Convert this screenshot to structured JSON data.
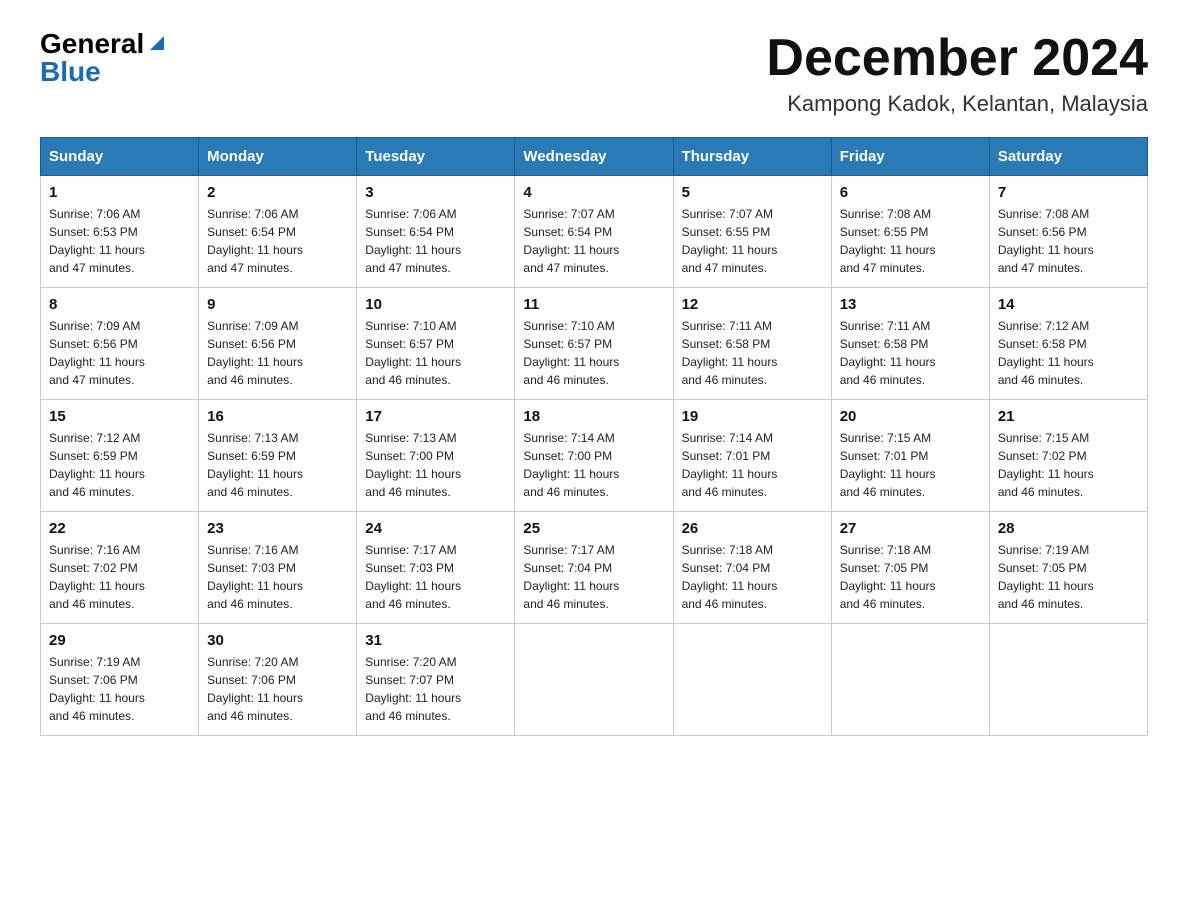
{
  "header": {
    "logo_general": "General",
    "logo_blue": "Blue",
    "month_title": "December 2024",
    "location": "Kampong Kadok, Kelantan, Malaysia"
  },
  "weekdays": [
    "Sunday",
    "Monday",
    "Tuesday",
    "Wednesday",
    "Thursday",
    "Friday",
    "Saturday"
  ],
  "weeks": [
    [
      {
        "day": "1",
        "sunrise": "7:06 AM",
        "sunset": "6:53 PM",
        "daylight": "11 hours and 47 minutes."
      },
      {
        "day": "2",
        "sunrise": "7:06 AM",
        "sunset": "6:54 PM",
        "daylight": "11 hours and 47 minutes."
      },
      {
        "day": "3",
        "sunrise": "7:06 AM",
        "sunset": "6:54 PM",
        "daylight": "11 hours and 47 minutes."
      },
      {
        "day": "4",
        "sunrise": "7:07 AM",
        "sunset": "6:54 PM",
        "daylight": "11 hours and 47 minutes."
      },
      {
        "day": "5",
        "sunrise": "7:07 AM",
        "sunset": "6:55 PM",
        "daylight": "11 hours and 47 minutes."
      },
      {
        "day": "6",
        "sunrise": "7:08 AM",
        "sunset": "6:55 PM",
        "daylight": "11 hours and 47 minutes."
      },
      {
        "day": "7",
        "sunrise": "7:08 AM",
        "sunset": "6:56 PM",
        "daylight": "11 hours and 47 minutes."
      }
    ],
    [
      {
        "day": "8",
        "sunrise": "7:09 AM",
        "sunset": "6:56 PM",
        "daylight": "11 hours and 47 minutes."
      },
      {
        "day": "9",
        "sunrise": "7:09 AM",
        "sunset": "6:56 PM",
        "daylight": "11 hours and 46 minutes."
      },
      {
        "day": "10",
        "sunrise": "7:10 AM",
        "sunset": "6:57 PM",
        "daylight": "11 hours and 46 minutes."
      },
      {
        "day": "11",
        "sunrise": "7:10 AM",
        "sunset": "6:57 PM",
        "daylight": "11 hours and 46 minutes."
      },
      {
        "day": "12",
        "sunrise": "7:11 AM",
        "sunset": "6:58 PM",
        "daylight": "11 hours and 46 minutes."
      },
      {
        "day": "13",
        "sunrise": "7:11 AM",
        "sunset": "6:58 PM",
        "daylight": "11 hours and 46 minutes."
      },
      {
        "day": "14",
        "sunrise": "7:12 AM",
        "sunset": "6:58 PM",
        "daylight": "11 hours and 46 minutes."
      }
    ],
    [
      {
        "day": "15",
        "sunrise": "7:12 AM",
        "sunset": "6:59 PM",
        "daylight": "11 hours and 46 minutes."
      },
      {
        "day": "16",
        "sunrise": "7:13 AM",
        "sunset": "6:59 PM",
        "daylight": "11 hours and 46 minutes."
      },
      {
        "day": "17",
        "sunrise": "7:13 AM",
        "sunset": "7:00 PM",
        "daylight": "11 hours and 46 minutes."
      },
      {
        "day": "18",
        "sunrise": "7:14 AM",
        "sunset": "7:00 PM",
        "daylight": "11 hours and 46 minutes."
      },
      {
        "day": "19",
        "sunrise": "7:14 AM",
        "sunset": "7:01 PM",
        "daylight": "11 hours and 46 minutes."
      },
      {
        "day": "20",
        "sunrise": "7:15 AM",
        "sunset": "7:01 PM",
        "daylight": "11 hours and 46 minutes."
      },
      {
        "day": "21",
        "sunrise": "7:15 AM",
        "sunset": "7:02 PM",
        "daylight": "11 hours and 46 minutes."
      }
    ],
    [
      {
        "day": "22",
        "sunrise": "7:16 AM",
        "sunset": "7:02 PM",
        "daylight": "11 hours and 46 minutes."
      },
      {
        "day": "23",
        "sunrise": "7:16 AM",
        "sunset": "7:03 PM",
        "daylight": "11 hours and 46 minutes."
      },
      {
        "day": "24",
        "sunrise": "7:17 AM",
        "sunset": "7:03 PM",
        "daylight": "11 hours and 46 minutes."
      },
      {
        "day": "25",
        "sunrise": "7:17 AM",
        "sunset": "7:04 PM",
        "daylight": "11 hours and 46 minutes."
      },
      {
        "day": "26",
        "sunrise": "7:18 AM",
        "sunset": "7:04 PM",
        "daylight": "11 hours and 46 minutes."
      },
      {
        "day": "27",
        "sunrise": "7:18 AM",
        "sunset": "7:05 PM",
        "daylight": "11 hours and 46 minutes."
      },
      {
        "day": "28",
        "sunrise": "7:19 AM",
        "sunset": "7:05 PM",
        "daylight": "11 hours and 46 minutes."
      }
    ],
    [
      {
        "day": "29",
        "sunrise": "7:19 AM",
        "sunset": "7:06 PM",
        "daylight": "11 hours and 46 minutes."
      },
      {
        "day": "30",
        "sunrise": "7:20 AM",
        "sunset": "7:06 PM",
        "daylight": "11 hours and 46 minutes."
      },
      {
        "day": "31",
        "sunrise": "7:20 AM",
        "sunset": "7:07 PM",
        "daylight": "11 hours and 46 minutes."
      },
      null,
      null,
      null,
      null
    ]
  ],
  "labels": {
    "sunrise": "Sunrise:",
    "sunset": "Sunset:",
    "daylight": "Daylight:"
  }
}
